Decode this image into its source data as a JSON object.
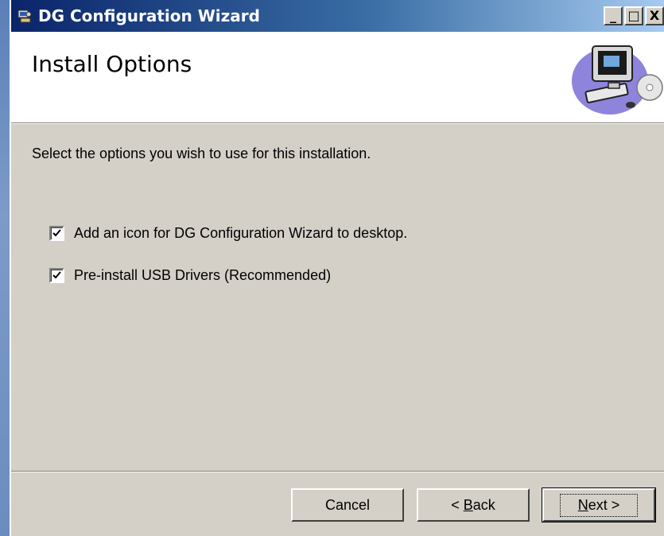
{
  "window": {
    "title": "DG Configuration Wizard",
    "controls": {
      "minimize": "_",
      "maximize": "□",
      "close": "X"
    }
  },
  "header": {
    "title": "Install Options",
    "art_icon": "computer-with-cd-icon"
  },
  "content": {
    "instruction": "Select the options you wish to use for this installation.",
    "options": [
      {
        "label": "Add an icon for DG Configuration Wizard to desktop.",
        "checked": true
      },
      {
        "label": "Pre-install USB Drivers (Recommended)",
        "checked": true
      }
    ]
  },
  "buttons": {
    "cancel": "Cancel",
    "back_prefix": "< ",
    "back_mnemonic": "B",
    "back_rest": "ack",
    "next_mnemonic": "N",
    "next_rest": "ext >"
  },
  "colors": {
    "titlebar_start": "#0a246a",
    "titlebar_end": "#a6caf0",
    "dialog_face": "#d4d0c8"
  }
}
